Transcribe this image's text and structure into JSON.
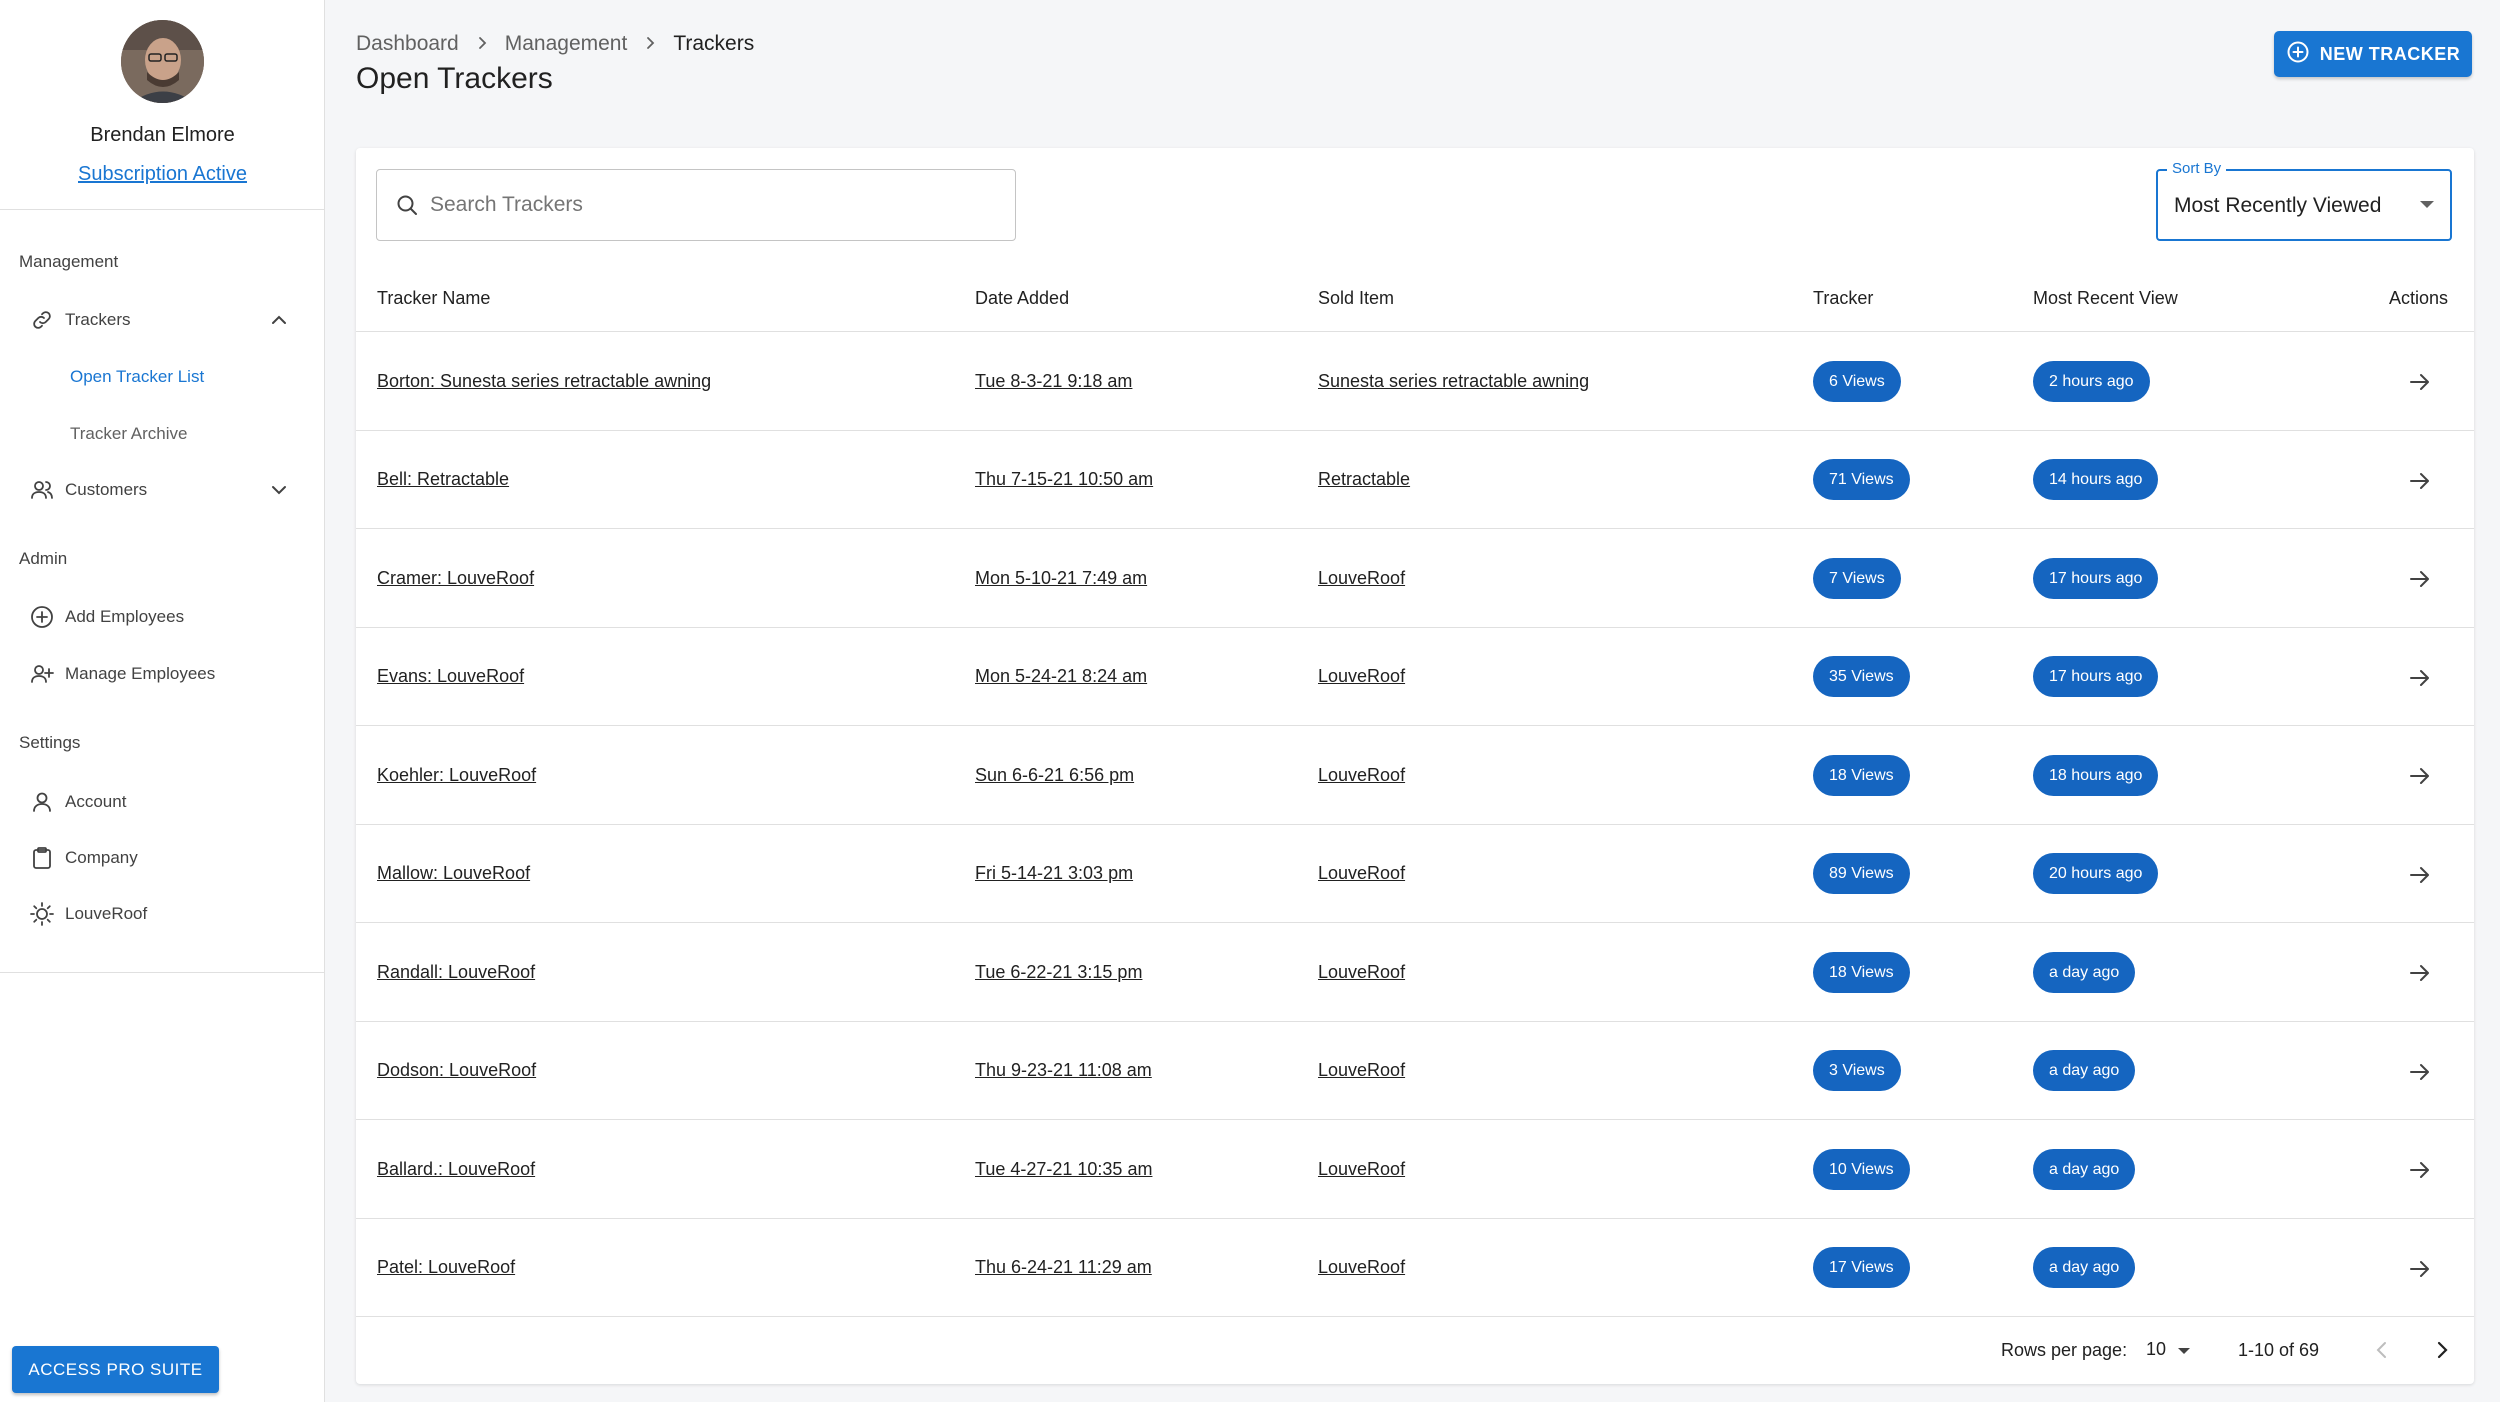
{
  "colors": {
    "primary": "#1976d2",
    "chip": "#1565c0",
    "page_bg": "#f5f6f8"
  },
  "sidebar": {
    "user_name": "Brendan Elmore",
    "subscription": "Subscription Active",
    "sections": {
      "management": "Management",
      "admin": "Admin",
      "settings": "Settings"
    },
    "items": {
      "trackers": "Trackers",
      "open_list": "Open Tracker List",
      "archive": "Tracker Archive",
      "customers": "Customers",
      "add_employees": "Add Employees",
      "manage_employees": "Manage Employees",
      "account": "Account",
      "company": "Company",
      "louveroof": "LouveRoof"
    },
    "pro_button": "ACCESS PRO SUITE"
  },
  "header": {
    "breadcrumb": [
      "Dashboard",
      "Management",
      "Trackers"
    ],
    "title": "Open Trackers",
    "new_button": "NEW TRACKER"
  },
  "search": {
    "placeholder": "Search Trackers",
    "value": ""
  },
  "sort": {
    "label": "Sort By",
    "value": "Most Recently Viewed"
  },
  "table": {
    "columns": [
      "Tracker Name",
      "Date Added",
      "Sold Item",
      "Tracker",
      "Most Recent View",
      "Actions"
    ],
    "rows": [
      {
        "name": "Borton: Sunesta series retractable awning",
        "date": "Tue 8-3-21 9:18 am",
        "item": "Sunesta series retractable awning",
        "views": "6 Views",
        "recent": "2 hours ago"
      },
      {
        "name": "Bell: Retractable",
        "date": "Thu 7-15-21 10:50 am",
        "item": "Retractable",
        "views": "71 Views",
        "recent": "14 hours ago"
      },
      {
        "name": "Cramer: LouveRoof",
        "date": "Mon 5-10-21 7:49 am",
        "item": "LouveRoof",
        "views": "7 Views",
        "recent": "17 hours ago"
      },
      {
        "name": "Evans: LouveRoof",
        "date": "Mon 5-24-21 8:24 am",
        "item": "LouveRoof",
        "views": "35 Views",
        "recent": "17 hours ago"
      },
      {
        "name": "Koehler: LouveRoof",
        "date": "Sun 6-6-21 6:56 pm",
        "item": "LouveRoof",
        "views": "18 Views",
        "recent": "18 hours ago"
      },
      {
        "name": "Mallow: LouveRoof",
        "date": "Fri 5-14-21 3:03 pm",
        "item": "LouveRoof",
        "views": "89 Views",
        "recent": "20 hours ago"
      },
      {
        "name": "Randall: LouveRoof",
        "date": "Tue 6-22-21 3:15 pm",
        "item": "LouveRoof",
        "views": "18 Views",
        "recent": "a day ago"
      },
      {
        "name": "Dodson: LouveRoof",
        "date": "Thu 9-23-21 11:08 am",
        "item": "LouveRoof",
        "views": "3 Views",
        "recent": "a day ago"
      },
      {
        "name": "Ballard.: LouveRoof",
        "date": "Tue 4-27-21 10:35 am",
        "item": "LouveRoof",
        "views": "10 Views",
        "recent": "a day ago"
      },
      {
        "name": "Patel: LouveRoof",
        "date": "Thu 6-24-21 11:29 am",
        "item": "LouveRoof",
        "views": "17 Views",
        "recent": "a day ago"
      }
    ]
  },
  "pagination": {
    "rows_label": "Rows per page:",
    "rows_value": "10",
    "range": "1-10 of 69"
  }
}
